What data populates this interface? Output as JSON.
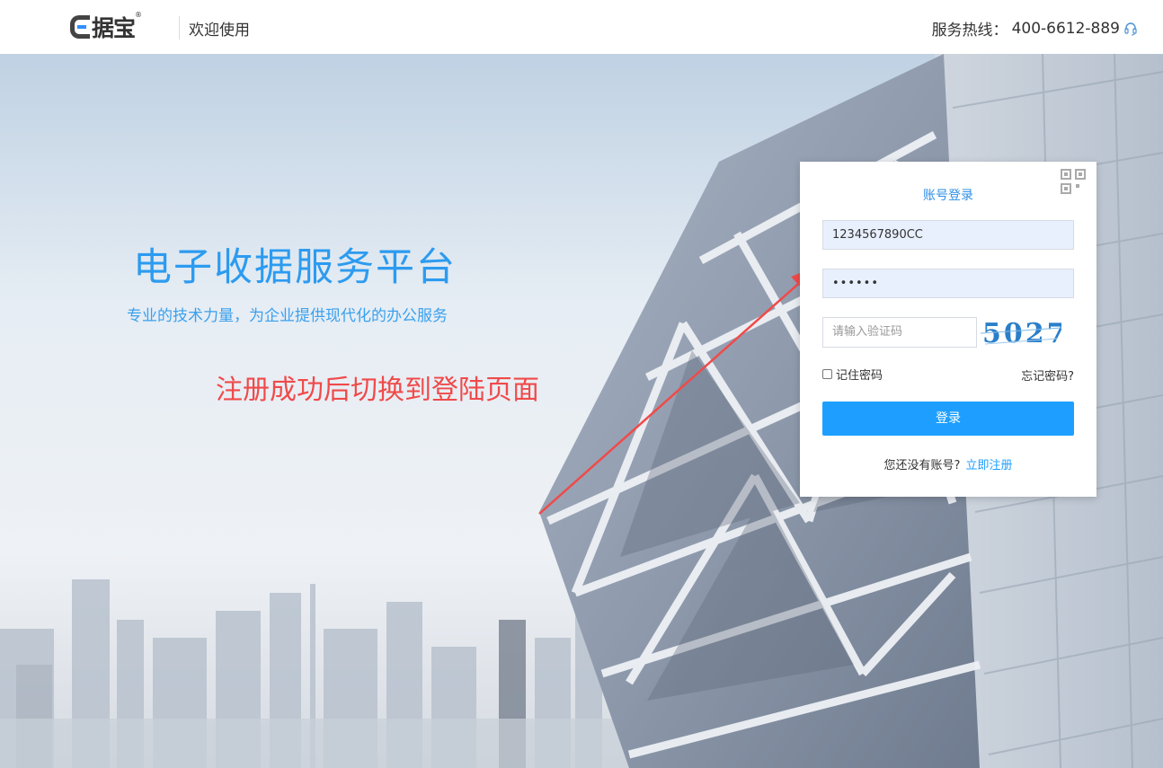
{
  "header": {
    "logo_text": "据宝",
    "logo_reg": "®",
    "welcome": "欢迎使用",
    "hotline_label": "服务热线：",
    "hotline_number": "400-6612-889",
    "hotline_icon": "headset-icon"
  },
  "hero": {
    "title": "电子收据服务平台",
    "subtitle": "专业的技术力量，为企业提供现代化的办公服务",
    "annotation": "注册成功后切换到登陆页面"
  },
  "login": {
    "title": "账号登录",
    "qr_icon": "qr-code-icon",
    "account_value": "1234567890CC",
    "password_mask": "••••••",
    "captcha_placeholder": "请输入验证码",
    "captcha_text": "5027",
    "remember_label": "记住密码",
    "forgot_label": "忘记密码?",
    "submit_label": "登录",
    "no_account_text": "您还没有账号?",
    "register_link": "立即注册"
  },
  "colors": {
    "accent": "#1e9fff",
    "slogan": "#2c9bf0",
    "annotation": "#f04a4a"
  }
}
